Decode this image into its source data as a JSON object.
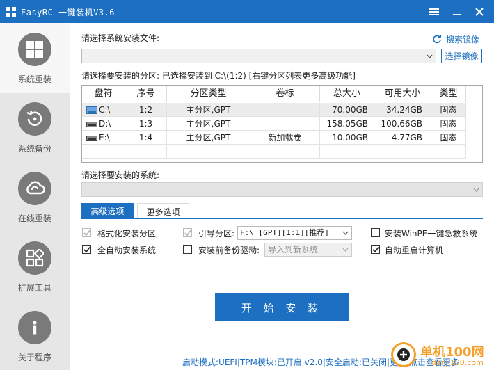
{
  "window": {
    "title": "EasyRC—一键装机V3.6",
    "controls": [
      "menu-icon",
      "minimize-icon",
      "close-icon"
    ]
  },
  "sidebar": {
    "items": [
      {
        "label": "系统重装",
        "icon": "windows-icon",
        "active": true
      },
      {
        "label": "系统备份",
        "icon": "backup-icon",
        "active": false
      },
      {
        "label": "在线重装",
        "icon": "cloud-icon",
        "active": false
      },
      {
        "label": "扩展工具",
        "icon": "grid-icon",
        "active": false
      },
      {
        "label": "关于程序",
        "icon": "info-icon",
        "active": false
      }
    ]
  },
  "main": {
    "file_label": "请选择系统安装文件:",
    "search_image_link": "搜索镜像",
    "file_value": "",
    "select_image_button": "选择镜像",
    "partition_label": "请选择要安装的分区: 已选择安装到 C:\\(1:2) [右键分区列表更多高级功能]",
    "table": {
      "headers": [
        "盘符",
        "序号",
        "分区类型",
        "卷标",
        "总大小",
        "可用大小",
        "类型"
      ],
      "rows": [
        {
          "drive": "C:\\",
          "index": "1:2",
          "ptype": "主分区,GPT",
          "volume": "",
          "total": "70.00GB",
          "free": "34.24GB",
          "kind": "固态",
          "selected": true
        },
        {
          "drive": "D:\\",
          "index": "1:3",
          "ptype": "主分区,GPT",
          "volume": "",
          "total": "158.05GB",
          "free": "100.66GB",
          "kind": "固态",
          "selected": false
        },
        {
          "drive": "E:\\",
          "index": "1:4",
          "ptype": "主分区,GPT",
          "volume": "新加载卷",
          "total": "10.00GB",
          "free": "4.77GB",
          "kind": "固态",
          "selected": false
        }
      ]
    },
    "system_label": "请选择要安装的系统:",
    "system_value": "",
    "tabs": [
      {
        "label": "高级选项",
        "active": true
      },
      {
        "label": "更多选项",
        "active": false
      }
    ],
    "options": {
      "format": {
        "label": "格式化安装分区",
        "checked": true,
        "disabled": true
      },
      "boot": {
        "label": "引导分区:",
        "checked": true,
        "disabled": true
      },
      "boot_value": "F:\\ [GPT][1:1][推荐]",
      "winpe": {
        "label": "安装WinPE一键急救系统",
        "checked": false,
        "disabled": false
      },
      "auto_install": {
        "label": "全自动安装系统",
        "checked": true,
        "disabled": false
      },
      "backup_driver": {
        "label": "安装前备份驱动:",
        "checked": false,
        "disabled": false
      },
      "backup_value": "导入到新系统",
      "auto_restart": {
        "label": "自动重启计算机",
        "checked": true,
        "disabled": false
      }
    },
    "install_button": "开 始 安 装",
    "status_text": "启动模式:UEFI|TPM模块:已开启 v2.0|安全启动:已关闭|更新|点击查看更多"
  },
  "watermark": {
    "text": "单机100网",
    "sub": "danji100.com"
  },
  "colors": {
    "accent": "#1d6fc1",
    "sidebar_bg": "#e6e6e6",
    "icon_gray": "#7a7a7a",
    "watermark": "#f3a02b"
  }
}
